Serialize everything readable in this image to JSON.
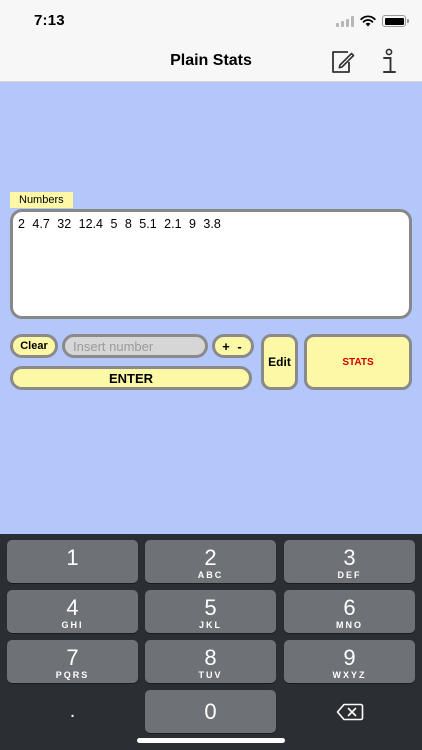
{
  "status_bar": {
    "time": "7:13"
  },
  "nav": {
    "title": "Plain Stats",
    "icons": [
      "edit-document-icon",
      "info-icon"
    ]
  },
  "numbers": {
    "label": "Numbers",
    "content": "2  4.7  32  12.4  5  8  5.1  2.1  9  3.8"
  },
  "controls": {
    "clear_label": "Clear",
    "input_placeholder": "Insert number",
    "input_value": "",
    "plusminus_label": "+ -",
    "enter_label": "ENTER",
    "edit_label": "Edit",
    "stats_label": "STATS"
  },
  "keyboard": {
    "keys": [
      {
        "digit": "1",
        "letters": ""
      },
      {
        "digit": "2",
        "letters": "ABC"
      },
      {
        "digit": "3",
        "letters": "DEF"
      },
      {
        "digit": "4",
        "letters": "GHI"
      },
      {
        "digit": "5",
        "letters": "JKL"
      },
      {
        "digit": "6",
        "letters": "MNO"
      },
      {
        "digit": "7",
        "letters": "PQRS"
      },
      {
        "digit": "8",
        "letters": "TUV"
      },
      {
        "digit": "9",
        "letters": "WXYZ"
      }
    ],
    "dot_label": ".",
    "zero_label": "0",
    "backspace_icon": "backspace-icon"
  },
  "colors": {
    "background_blue": "#b3c7fb",
    "button_yellow": "#fdf8a6",
    "stats_red": "#d40000",
    "keyboard_dark": "#2b2e33",
    "key_gray": "#6e7176"
  }
}
